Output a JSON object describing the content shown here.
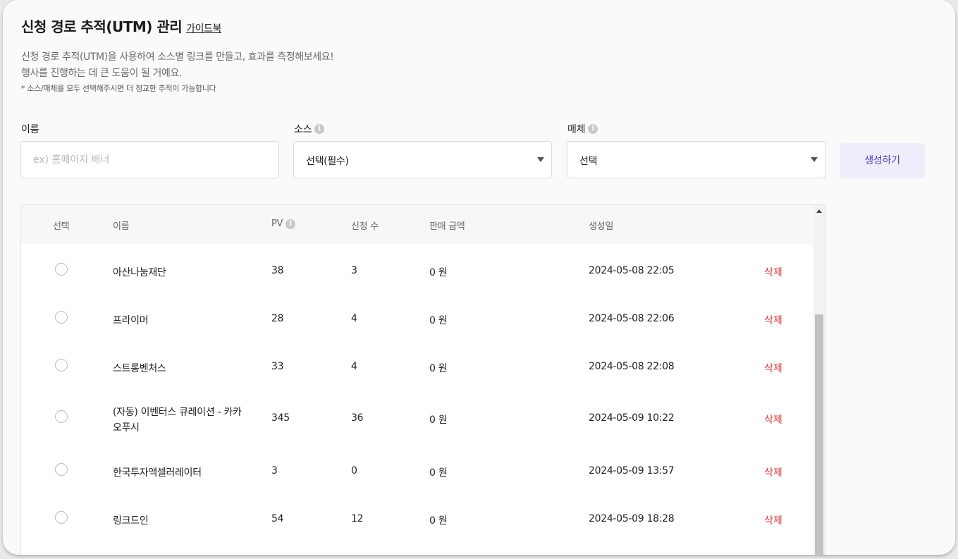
{
  "page": {
    "title": "신청 경로 추적(UTM) 관리",
    "guide_link": "가이드북",
    "desc_line1": "신청 경로 추적(UTM)을 사용하여 소스별 링크를 만들고, 효과를 측정해보세요!",
    "desc_line2": "행사를 진행하는 데 큰 도움이 될 거예요.",
    "note": "* 소스/매체를 모두 선택해주시면 더 정교한 추적이 가능합니다"
  },
  "form": {
    "name_label": "이름",
    "name_placeholder": "ex) 홈페이지 배너",
    "source_label": "소스",
    "source_value": "선택(필수)",
    "medium_label": "매체",
    "medium_value": "선택",
    "create_button": "생성하기",
    "info_glyph": "i"
  },
  "table": {
    "headers": {
      "select": "선택",
      "name": "이름",
      "pv": "PV",
      "applications": "신청 수",
      "sales": "판매 금액",
      "created": "생성일"
    },
    "delete_label": "삭제",
    "rows": [
      {
        "name": "아산나눔재단",
        "pv": "38",
        "applications": "3",
        "sales": "0 원",
        "created": "2024-05-08 22:05"
      },
      {
        "name": "프라이머",
        "pv": "28",
        "applications": "4",
        "sales": "0 원",
        "created": "2024-05-08 22:06"
      },
      {
        "name": "스트롱벤처스",
        "pv": "33",
        "applications": "4",
        "sales": "0 원",
        "created": "2024-05-08 22:08"
      },
      {
        "name_line1": "(자동) 이벤터스 큐레이션 - 카카",
        "name_line2": "오푸시",
        "pv": "345",
        "applications": "36",
        "sales": "0 원",
        "created": "2024-05-09 10:22"
      },
      {
        "name": "한국투자액셀러레이터",
        "pv": "3",
        "applications": "0",
        "sales": "0 원",
        "created": "2024-05-09 13:57"
      },
      {
        "name": "링크드인",
        "pv": "54",
        "applications": "12",
        "sales": "0 원",
        "created": "2024-05-09 18:28"
      }
    ]
  }
}
